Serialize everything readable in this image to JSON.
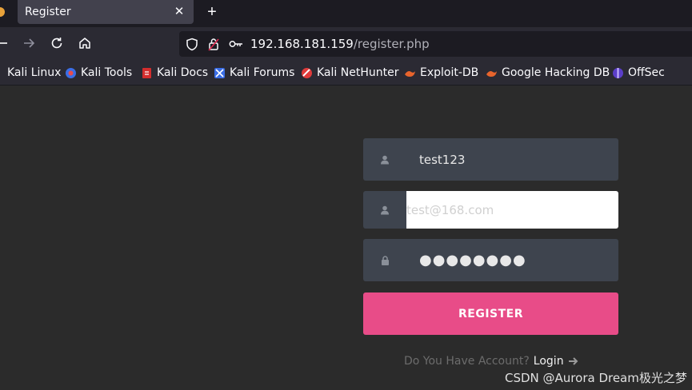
{
  "browser": {
    "tab": {
      "title": "Register",
      "close_glyph": "✕"
    },
    "new_tab_glyph": "+",
    "url": {
      "host": "192.168.181.159",
      "path": "/register.php"
    },
    "bookmarks": [
      {
        "label": "Kali Linux",
        "icon": "kali-linux-icon",
        "color": "#367bf0"
      },
      {
        "label": "Kali Tools",
        "icon": "kali-tools-icon",
        "color": "#4a7bd8"
      },
      {
        "label": "Kali Docs",
        "icon": "kali-docs-icon",
        "color": "#d42d2d"
      },
      {
        "label": "Kali Forums",
        "icon": "kali-forums-icon",
        "color": "#3b6ee6"
      },
      {
        "label": "Kali NetHunter",
        "icon": "kali-nethunter-icon",
        "color": "#e03a3a"
      },
      {
        "label": "Exploit-DB",
        "icon": "exploit-db-icon",
        "color": "#e8642c"
      },
      {
        "label": "Google Hacking DB",
        "icon": "ghdb-icon",
        "color": "#e8642c"
      },
      {
        "label": "OffSec",
        "icon": "offsec-icon",
        "color": "#8a5cf5"
      }
    ]
  },
  "form": {
    "username": {
      "value": "test123",
      "icon": "user-icon"
    },
    "email": {
      "value": "test@168.com",
      "icon": "user-icon"
    },
    "password": {
      "value": "●●●●●●●●",
      "icon": "lock-icon"
    },
    "submit_label": "REGISTER",
    "account_question": "Do You Have Account?",
    "login_label": "Login"
  },
  "watermark": "CSDN @Aurora Dream极光之梦",
  "colors": {
    "accent": "#e84c88",
    "field_bg": "#3e444e",
    "page_bg": "#2b2b2b"
  }
}
